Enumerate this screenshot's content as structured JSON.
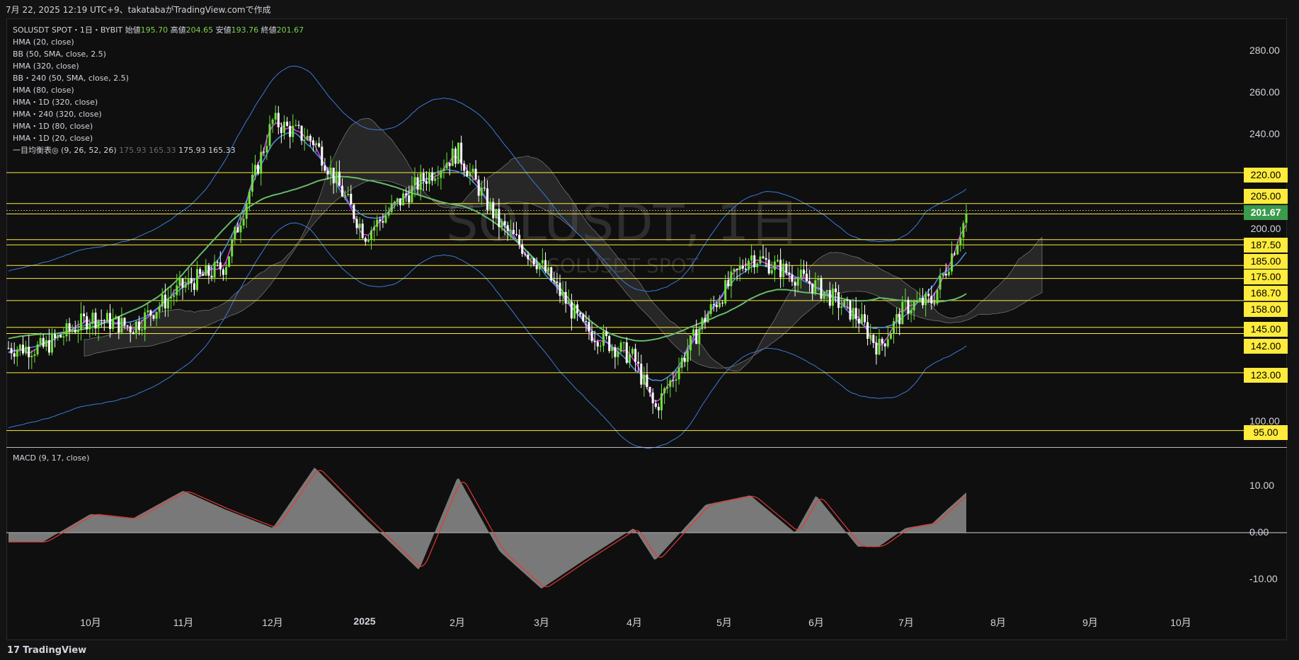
{
  "header": {
    "caption": "7月 22, 2025 12:19 UTC+9、takatabaがTradingView.comで作成"
  },
  "symbol": {
    "title": "SOLUSDT SPOT・1日・BYBIT",
    "open_label": "始値",
    "open": "195.70",
    "high_label": "高値",
    "high": "204.65",
    "low_label": "安値",
    "low": "193.76",
    "close_label": "終値",
    "close": "201.67",
    "watermark_main": "SOLUSDT, 1日",
    "watermark_sub": "SOLUSDT SPOT"
  },
  "indicators": [
    "HMA (20, close)",
    "BB (50, SMA, close, 2.5)",
    "HMA (320, close)",
    "BB・240 (50, SMA, close, 2.5)",
    "HMA (80, close)",
    "HMA・1D (320, close)",
    "HMA・240 (320, close)",
    "HMA・1D (80, close)",
    "HMA・1D (20, close)"
  ],
  "ichimoku": {
    "label": "一目均衡表◎ (9, 26, 52, 26)",
    "v1": "175.93",
    "v2": "165.33",
    "v3": "175.93",
    "v4": "165.33"
  },
  "macd": {
    "label": "MACD (9, 17, close)"
  },
  "price_axis": {
    "ticks": [
      "280.00",
      "260.00",
      "240.00",
      "200.00",
      "100.00"
    ],
    "levels": [
      "220.00",
      "205.00",
      "200.00",
      "187.50",
      "185.00",
      "175.00",
      "168.70",
      "158.00",
      "145.00",
      "142.00",
      "123.00",
      "95.00"
    ],
    "last": "201.67"
  },
  "macd_axis": {
    "ticks": [
      "10.00",
      "0.00",
      "-10.00"
    ]
  },
  "time_axis": {
    "labels": [
      "10月",
      "11月",
      "12月",
      "2025",
      "2月",
      "3月",
      "4月",
      "5月",
      "6月",
      "7月",
      "8月",
      "9月",
      "10月"
    ]
  },
  "footer": {
    "brand": "TradingView",
    "brand_mark": "𝟭𝟳"
  },
  "colors": {
    "up": "#6ee03a",
    "down": "#ffffff",
    "level": "#ffeb3b",
    "hma20": "#e040fb",
    "hma80": "#4a90e2",
    "hma320": "#66bb6a",
    "bb": "#3b7ad8",
    "cloud": "#555555",
    "macd_signal": "#e53935",
    "macd_hist": "#9e9e9e"
  },
  "chart_data": {
    "type": "line",
    "title": "SOLUSDT SPOT・1日・BYBIT",
    "xlabel": "",
    "ylabel": "",
    "ylim": [
      90,
      296
    ],
    "x": [
      "2024-09-15",
      "2024-10-01",
      "2024-10-15",
      "2024-11-01",
      "2024-11-15",
      "2024-12-01",
      "2024-12-15",
      "2025-01-01",
      "2025-01-19",
      "2025-02-01",
      "2025-02-15",
      "2025-03-01",
      "2025-03-15",
      "2025-04-01",
      "2025-04-08",
      "2025-04-25",
      "2025-05-10",
      "2025-05-25",
      "2025-06-01",
      "2025-06-15",
      "2025-06-22",
      "2025-07-01",
      "2025-07-10",
      "2025-07-15",
      "2025-07-22"
    ],
    "series": [
      {
        "values": [
          135,
          150,
          145,
          165,
          175,
          245,
          235,
          190,
          215,
          230,
          195,
          175,
          145,
          130,
          105,
          150,
          180,
          170,
          165,
          150,
          135,
          155,
          158,
          175,
          201.67
        ]
      }
    ],
    "horizontal_levels": [
      220,
      205,
      200,
      187.5,
      185,
      175,
      168.7,
      158,
      145,
      142,
      123,
      95
    ],
    "macd": {
      "values": [
        -2,
        4,
        3,
        9,
        5,
        1,
        14,
        3,
        -8,
        12,
        -4,
        -12,
        -6,
        1,
        -6,
        6,
        8,
        0,
        8,
        -3,
        -3,
        1,
        2,
        5,
        9
      ],
      "yticks": [
        10,
        0,
        -10
      ]
    }
  }
}
